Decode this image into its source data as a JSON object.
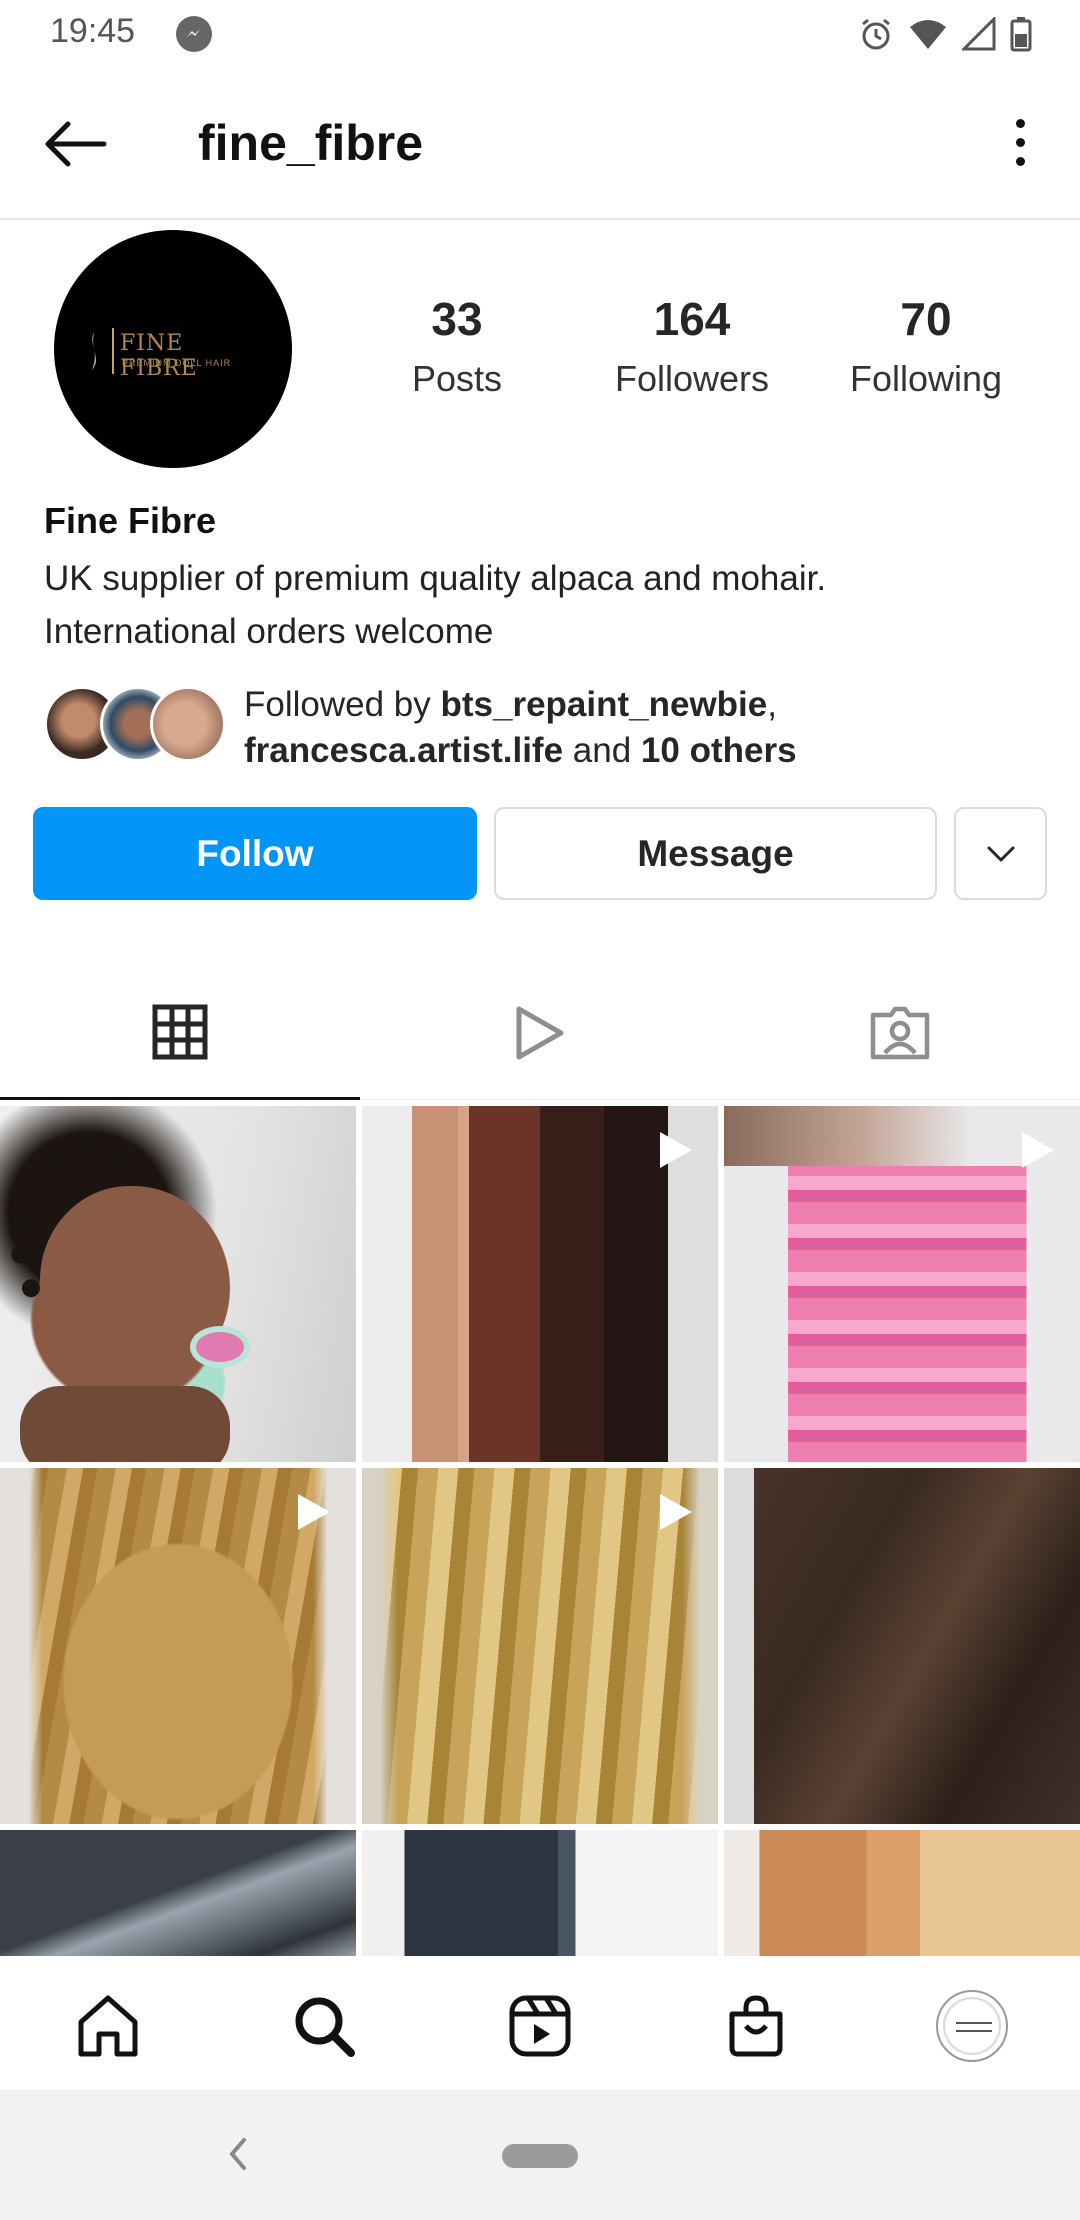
{
  "status_bar": {
    "time": "19:45"
  },
  "header": {
    "username": "fine_fibre"
  },
  "profile": {
    "avatar_icon": "fine-fibre-logo",
    "avatar_brand": "FINE FIBRE",
    "avatar_tagline": "PREMIUM DOLL HAIR",
    "stats": {
      "posts": {
        "value": "33",
        "label": "Posts"
      },
      "followers": {
        "value": "164",
        "label": "Followers"
      },
      "following": {
        "value": "70",
        "label": "Following"
      }
    },
    "display_name": "Fine Fibre",
    "bio_line1": "UK supplier of premium quality alpaca and mohair.",
    "bio_line2": "International orders welcome",
    "followed_by": {
      "prefix": "Followed by ",
      "user1": "bts_repaint_newbie",
      "sep": ",",
      "user2": "francesca.artist.life",
      "joiner": " and ",
      "others": "10 others"
    }
  },
  "actions": {
    "follow_label": "Follow",
    "message_label": "Message",
    "suggest_icon": "chevron-down-icon",
    "follow_color": "#0095f6"
  },
  "tabs": [
    {
      "icon": "grid-icon",
      "active": true
    },
    {
      "icon": "reels-play-icon",
      "active": false
    },
    {
      "icon": "tagged-person-icon",
      "active": false
    }
  ],
  "posts": [
    {
      "type": "photo",
      "subject": "doll with curly hair and pacifier"
    },
    {
      "type": "video",
      "subject": "straight hair wefts in ginger, auburn and black"
    },
    {
      "type": "video",
      "subject": "pink wavy mohair"
    },
    {
      "type": "video",
      "subject": "golden wavy mohair"
    },
    {
      "type": "video",
      "subject": "blonde wavy mohair"
    },
    {
      "type": "photo",
      "subject": "dark brown straight hair"
    },
    {
      "type": "photo",
      "subject": "grey silver hair"
    },
    {
      "type": "photo",
      "subject": "navy and white hair"
    },
    {
      "type": "photo",
      "subject": "copper and blonde hair"
    }
  ],
  "bottom_nav": [
    {
      "icon": "home-icon"
    },
    {
      "icon": "search-icon",
      "active": true
    },
    {
      "icon": "reels-icon"
    },
    {
      "icon": "shop-icon"
    },
    {
      "icon": "profile-avatar"
    }
  ]
}
